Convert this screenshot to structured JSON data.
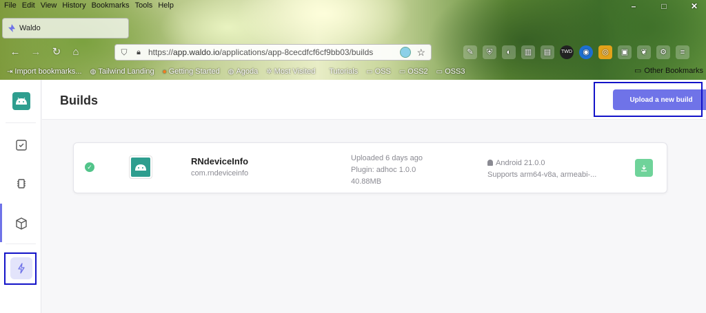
{
  "browser": {
    "menu": [
      "File",
      "Edit",
      "View",
      "History",
      "Bookmarks",
      "Tools",
      "Help"
    ],
    "window_controls": [
      "–",
      "□",
      "✕"
    ],
    "tab_title": "Waldo",
    "url_scheme": "https://",
    "url_host": "app.waldo.io",
    "url_path": "/applications/app-8cecdfcf6cf9bb03/builds",
    "bookmarks": [
      {
        "icon": "import-icon",
        "label": "Import bookmarks..."
      },
      {
        "icon": "globe-icon",
        "label": "Tailwind Landing"
      },
      {
        "icon": "firefox-icon",
        "label": "Getting Started"
      },
      {
        "icon": "globe-icon",
        "label": "Agoda"
      },
      {
        "icon": "gear-icon",
        "label": "Most Visited"
      },
      {
        "icon": "",
        "label": "Tutorials"
      },
      {
        "icon": "folder-icon",
        "label": "OSS"
      },
      {
        "icon": "folder-icon",
        "label": "OSS2"
      },
      {
        "icon": "folder-icon",
        "label": "OSS3"
      }
    ],
    "other_bookmarks": "Other Bookmarks",
    "toolbar_icons": [
      "wrench-icon",
      "shield-icon",
      "extension-icon",
      "library-icon",
      "sidebar-icon",
      "twd-icon",
      "globe-icon",
      "extension-icon",
      "notes-icon",
      "paw-icon",
      "gear-icon",
      "menu-icon"
    ]
  },
  "sidebar": {
    "logo": "android-logo",
    "items": [
      "checklist-icon",
      "chip-icon",
      "box-icon",
      "bolt-icon"
    ]
  },
  "header": {
    "title": "Builds",
    "upload_label": "Upload a new build"
  },
  "build": {
    "status": "success",
    "app_name": "RNdeviceInfo",
    "package": "com.rndeviceinfo",
    "uploaded": "Uploaded 6 days ago",
    "plugin": "Plugin: adhoc 1.0.0",
    "size": "40.88MB",
    "os": "Android 21.0.0",
    "abis": "Supports arm64-v8a, armeabi-..."
  },
  "colors": {
    "accent": "#6f73e8",
    "success": "#52c48a",
    "android_teal": "#2e9e8f",
    "highlight_box": "#1212c8"
  }
}
